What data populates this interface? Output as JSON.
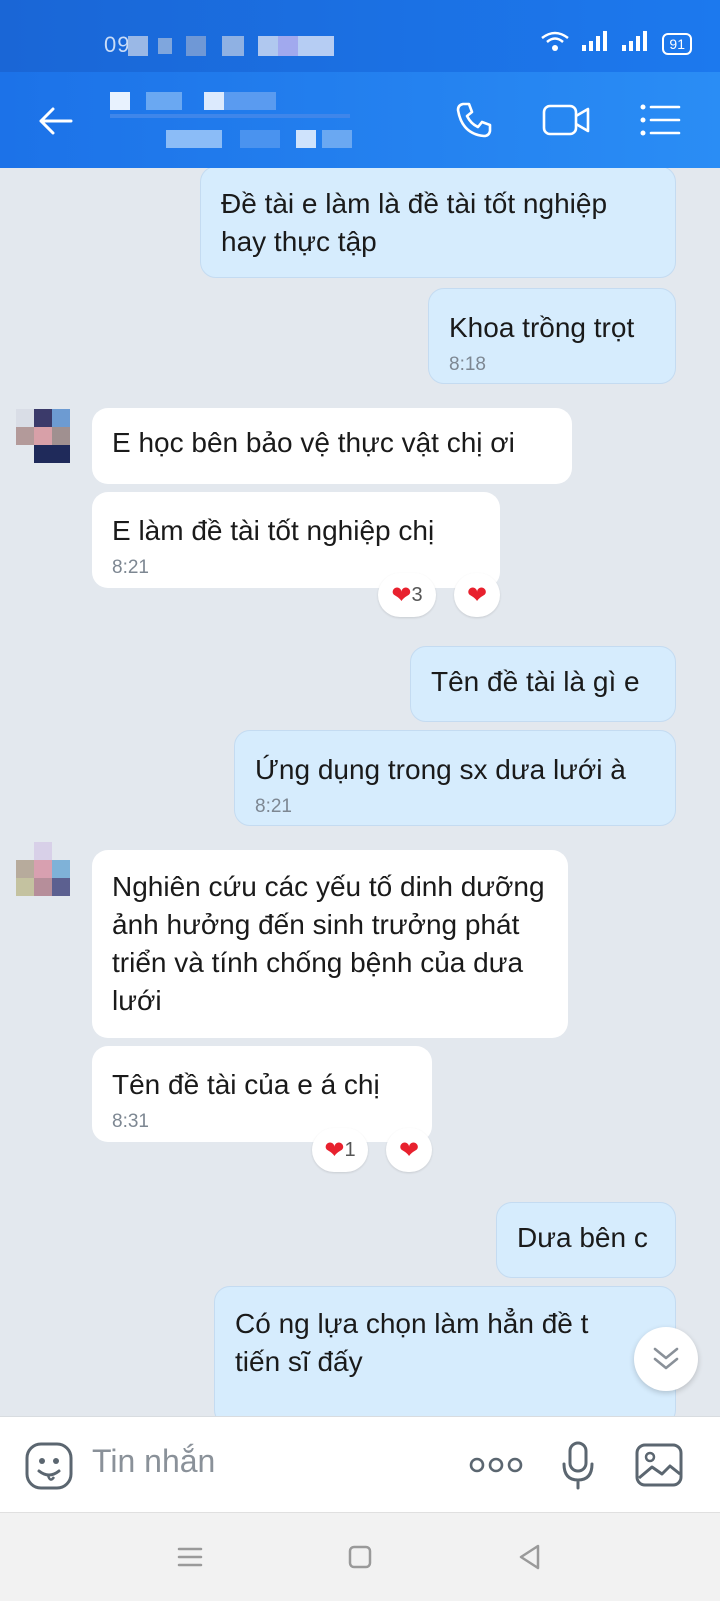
{
  "status_bar": {
    "time": "09:",
    "battery": "91"
  },
  "header": {
    "back_icon": "arrow-left-icon",
    "call_icon": "phone-icon",
    "video_icon": "video-camera-icon",
    "menu_icon": "list-menu-icon"
  },
  "messages": [
    {
      "dir": "out",
      "text": "Đề tài e làm là đề tài tốt nghiệp hay thực tập",
      "time": ""
    },
    {
      "dir": "out",
      "text": "Khoa trồng trọt",
      "time": "8:18"
    },
    {
      "dir": "in",
      "text": "E học bên bảo vệ thực vật chị ơi",
      "time": ""
    },
    {
      "dir": "in",
      "text": "E làm đề tài tốt nghiệp chị",
      "time": "8:21"
    },
    {
      "dir": "out",
      "text": "Tên đề tài là gì e",
      "time": ""
    },
    {
      "dir": "out",
      "text": "Ứng dụng trong sx dưa lưới à",
      "time": "8:21"
    },
    {
      "dir": "in",
      "text": "Nghiên cứu các yếu tố dinh dưỡng ảnh hưởng đến sinh trưởng phát triển và tính chống bệnh của dưa lưới",
      "time": ""
    },
    {
      "dir": "in",
      "text": "Tên đề tài của e á chị",
      "time": "8:31"
    },
    {
      "dir": "out",
      "text": "Dưa bên c",
      "time": ""
    },
    {
      "dir": "out",
      "text": "Có ng lựa chọn làm hẳn đề t tiến sĩ đấy",
      "time": ""
    }
  ],
  "reactions": [
    {
      "emoji": "❤",
      "count": "3"
    },
    {
      "emoji": "❤",
      "count": ""
    },
    {
      "emoji": "❤",
      "count": "1"
    },
    {
      "emoji": "❤",
      "count": ""
    }
  ],
  "input": {
    "placeholder": "Tin nhắn"
  },
  "colors": {
    "header": "#1c72e8",
    "outgoing": "#d6ecfd",
    "incoming": "#ffffff",
    "background": "#e3e8ee",
    "heart": "#e8212e"
  }
}
